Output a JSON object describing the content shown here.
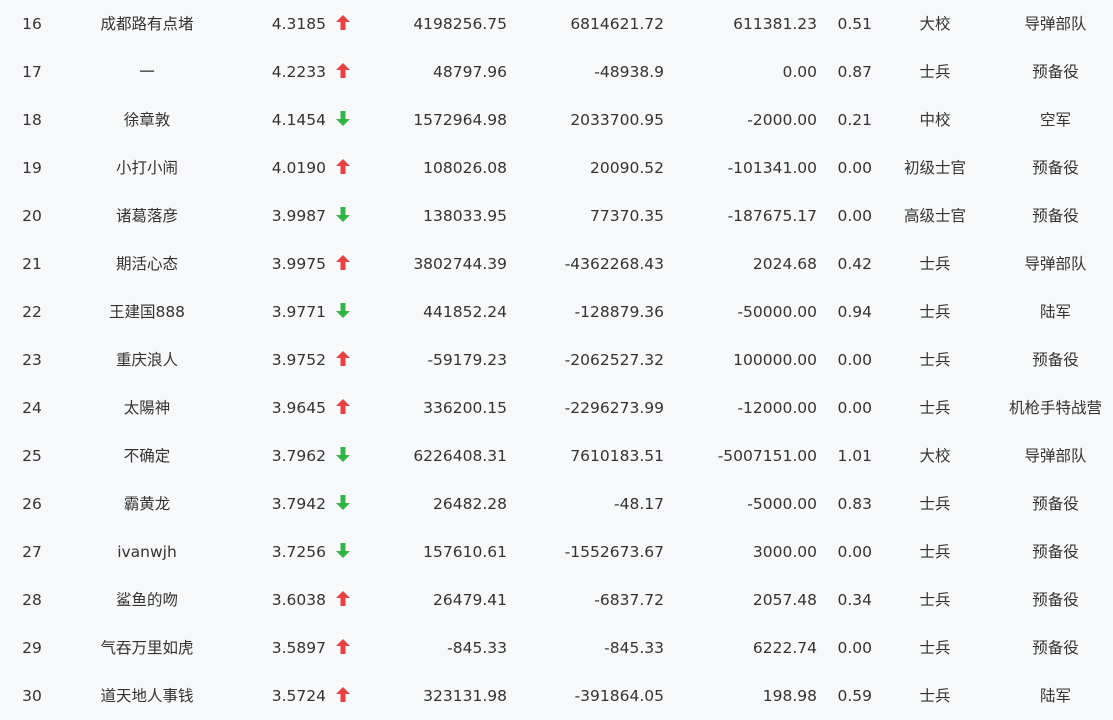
{
  "colors": {
    "up": "#e84142",
    "down": "#36b347",
    "background": "#f7f8fa",
    "text": "#333333"
  },
  "rows": [
    {
      "rank": "16",
      "name": "成都路有点堵",
      "score": "4.3185",
      "trend": "up",
      "trend_icon": "arrow-up-icon",
      "v1": "4198256.75",
      "v2": "6814621.72",
      "v3": "611381.23",
      "ratio": "0.51",
      "military_rank": "大校",
      "unit": "导弹部队"
    },
    {
      "rank": "17",
      "name": "一",
      "score": "4.2233",
      "trend": "up",
      "trend_icon": "arrow-up-icon",
      "v1": "48797.96",
      "v2": "-48938.9",
      "v3": "0.00",
      "ratio": "0.87",
      "military_rank": "士兵",
      "unit": "预备役"
    },
    {
      "rank": "18",
      "name": "徐章敦",
      "score": "4.1454",
      "trend": "down",
      "trend_icon": "arrow-down-icon",
      "v1": "1572964.98",
      "v2": "2033700.95",
      "v3": "-2000.00",
      "ratio": "0.21",
      "military_rank": "中校",
      "unit": "空军"
    },
    {
      "rank": "19",
      "name": "小打小闹",
      "score": "4.0190",
      "trend": "up",
      "trend_icon": "arrow-up-icon",
      "v1": "108026.08",
      "v2": "20090.52",
      "v3": "-101341.00",
      "ratio": "0.00",
      "military_rank": "初级士官",
      "unit": "预备役"
    },
    {
      "rank": "20",
      "name": "诸葛落彦",
      "score": "3.9987",
      "trend": "down",
      "trend_icon": "arrow-down-icon",
      "v1": "138033.95",
      "v2": "77370.35",
      "v3": "-187675.17",
      "ratio": "0.00",
      "military_rank": "高级士官",
      "unit": "预备役"
    },
    {
      "rank": "21",
      "name": "期活心态",
      "score": "3.9975",
      "trend": "up",
      "trend_icon": "arrow-up-icon",
      "v1": "3802744.39",
      "v2": "-4362268.43",
      "v3": "2024.68",
      "ratio": "0.42",
      "military_rank": "士兵",
      "unit": "导弹部队"
    },
    {
      "rank": "22",
      "name": "王建国888",
      "score": "3.9771",
      "trend": "down",
      "trend_icon": "arrow-down-icon",
      "v1": "441852.24",
      "v2": "-128879.36",
      "v3": "-50000.00",
      "ratio": "0.94",
      "military_rank": "士兵",
      "unit": "陆军"
    },
    {
      "rank": "23",
      "name": "重庆浪人",
      "score": "3.9752",
      "trend": "up",
      "trend_icon": "arrow-up-icon",
      "v1": "-59179.23",
      "v2": "-2062527.32",
      "v3": "100000.00",
      "ratio": "0.00",
      "military_rank": "士兵",
      "unit": "预备役"
    },
    {
      "rank": "24",
      "name": "太陽神",
      "score": "3.9645",
      "trend": "up",
      "trend_icon": "arrow-up-icon",
      "v1": "336200.15",
      "v2": "-2296273.99",
      "v3": "-12000.00",
      "ratio": "0.00",
      "military_rank": "士兵",
      "unit": "机枪手特战营"
    },
    {
      "rank": "25",
      "name": "不确定",
      "score": "3.7962",
      "trend": "down",
      "trend_icon": "arrow-down-icon",
      "v1": "6226408.31",
      "v2": "7610183.51",
      "v3": "-5007151.00",
      "ratio": "1.01",
      "military_rank": "大校",
      "unit": "导弹部队"
    },
    {
      "rank": "26",
      "name": "霸黄龙",
      "score": "3.7942",
      "trend": "down",
      "trend_icon": "arrow-down-icon",
      "v1": "26482.28",
      "v2": "-48.17",
      "v3": "-5000.00",
      "ratio": "0.83",
      "military_rank": "士兵",
      "unit": "预备役"
    },
    {
      "rank": "27",
      "name": "ivanwjh",
      "score": "3.7256",
      "trend": "down",
      "trend_icon": "arrow-down-icon",
      "v1": "157610.61",
      "v2": "-1552673.67",
      "v3": "3000.00",
      "ratio": "0.00",
      "military_rank": "士兵",
      "unit": "预备役"
    },
    {
      "rank": "28",
      "name": "鲨鱼的吻",
      "score": "3.6038",
      "trend": "up",
      "trend_icon": "arrow-up-icon",
      "v1": "26479.41",
      "v2": "-6837.72",
      "v3": "2057.48",
      "ratio": "0.34",
      "military_rank": "士兵",
      "unit": "预备役"
    },
    {
      "rank": "29",
      "name": "气吞万里如虎",
      "score": "3.5897",
      "trend": "up",
      "trend_icon": "arrow-up-icon",
      "v1": "-845.33",
      "v2": "-845.33",
      "v3": "6222.74",
      "ratio": "0.00",
      "military_rank": "士兵",
      "unit": "预备役"
    },
    {
      "rank": "30",
      "name": "道天地人事钱",
      "score": "3.5724",
      "trend": "up",
      "trend_icon": "arrow-up-icon",
      "v1": "323131.98",
      "v2": "-391864.05",
      "v3": "198.98",
      "ratio": "0.59",
      "military_rank": "士兵",
      "unit": "陆军"
    }
  ]
}
